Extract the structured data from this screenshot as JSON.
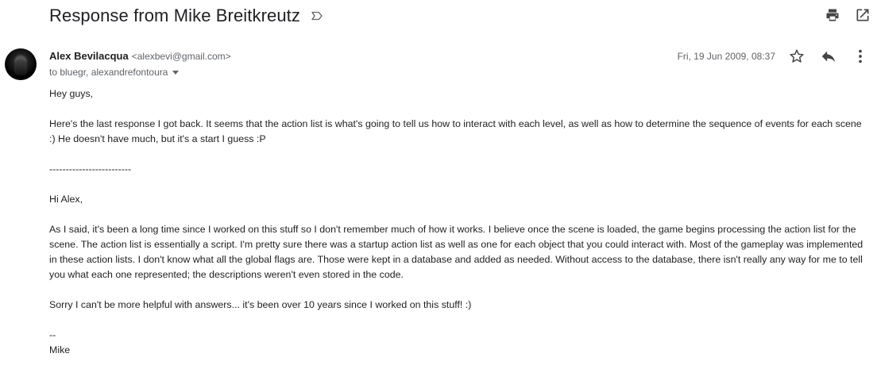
{
  "subject": "Response from Mike Breitkreutz",
  "icons": {
    "label": "label-outline-icon",
    "print": "print-icon",
    "open_new_window": "open-in-new-icon",
    "star": "star-outline-icon",
    "reply": "reply-icon",
    "more": "more-vert-icon"
  },
  "sender": {
    "name": "Alex Bevilacqua",
    "email": "<alexbevi@gmail.com>",
    "recipients": "to bluegr, alexandrefontoura"
  },
  "date": "Fri, 19 Jun 2009, 08:37",
  "body": {
    "greeting": "Hey guys,",
    "intro": "Here's the last response I got back. It seems that the action list is what's going to tell us how to interact with each level, as well as how to determine the sequence of events for each scene :) He doesn't have much, but it's a start I guess :P",
    "separator": "-------------------------",
    "quoted_greeting": "Hi Alex,",
    "quoted_para1": "As I said, it's been a long time since I worked on this stuff so I don't remember much of how it works. I believe once the scene is loaded, the game begins processing the action list for the scene. The action list is essentially a script. I'm pretty sure there was a startup action list as well as one for each object that you could interact with. Most of the gameplay was implemented in these action lists. I don't know what all the global flags are. Those were kept in a database and added as needed. Without access to the database, there isn't really any way for me to tell you what each one represented; the descriptions weren't even stored in the code.",
    "quoted_para2": "Sorry I can't be more helpful with answers... it's been over 10 years since I worked on this stuff! :)",
    "sig_dash": "--",
    "sig_name": "Mike"
  }
}
